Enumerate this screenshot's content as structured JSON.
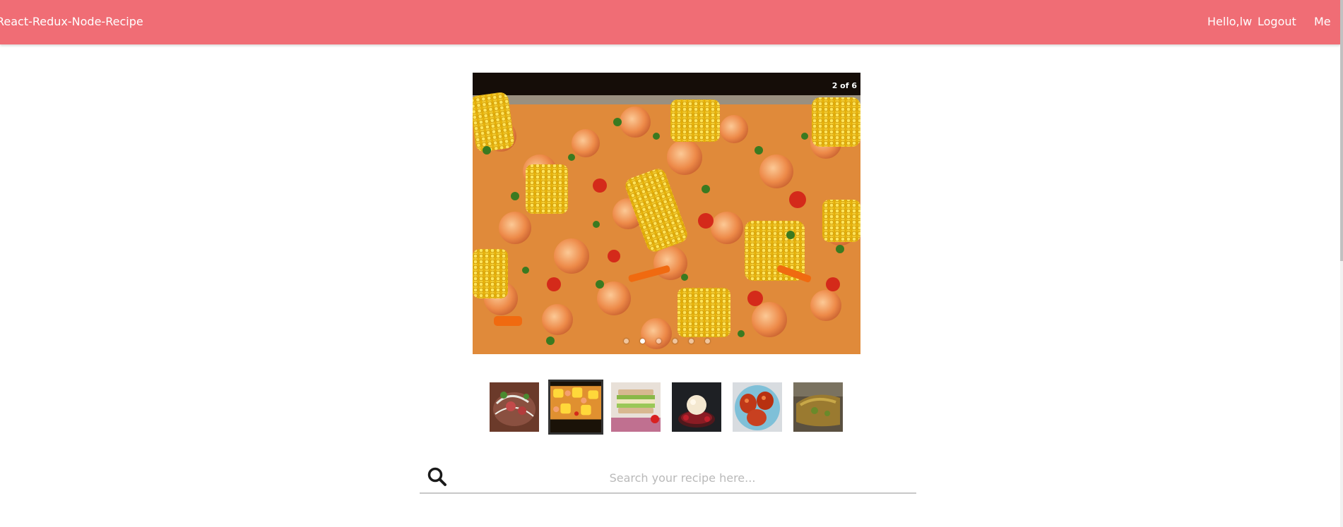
{
  "navbar": {
    "brand": "React-Redux-Node-Recipe",
    "greeting": "Hello,lw",
    "logout": "Logout",
    "me": "Me",
    "color": "#f06d75"
  },
  "carousel": {
    "counter": "2 of 6",
    "current": 2,
    "total": 6,
    "slide_description": "shrimp, corn and sausage boil on a baking tray"
  },
  "thumbnails": [
    {
      "subject": "salad with meat",
      "selected": false
    },
    {
      "subject": "shrimp and corn tray",
      "selected": true
    },
    {
      "subject": "layered sandwich",
      "selected": false
    },
    {
      "subject": "ice cream with berries",
      "selected": false
    },
    {
      "subject": "glazed chicken wings",
      "selected": false
    },
    {
      "subject": "roasted meat",
      "selected": false
    }
  ],
  "search": {
    "placeholder": "Search your recipe here...",
    "value": "",
    "icon": "search-icon"
  }
}
